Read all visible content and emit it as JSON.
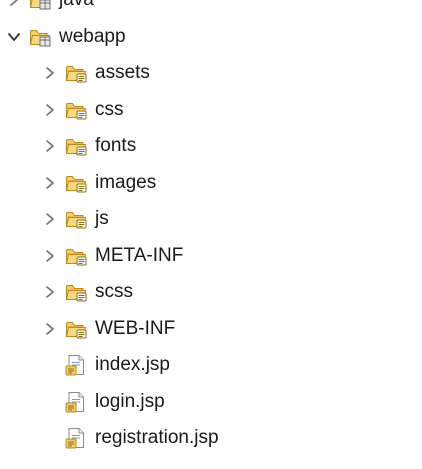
{
  "explorer": {
    "partial_top_item": {
      "label": "java"
    },
    "root": {
      "label": "webapp",
      "expanded": true
    },
    "children": [
      {
        "label": "assets",
        "type": "folder"
      },
      {
        "label": "css",
        "type": "folder"
      },
      {
        "label": "fonts",
        "type": "folder"
      },
      {
        "label": "images",
        "type": "folder"
      },
      {
        "label": "js",
        "type": "folder"
      },
      {
        "label": "META-INF",
        "type": "folder"
      },
      {
        "label": "scss",
        "type": "folder"
      },
      {
        "label": "WEB-INF",
        "type": "folder"
      },
      {
        "label": "index.jsp",
        "type": "file"
      },
      {
        "label": "login.jsp",
        "type": "file"
      },
      {
        "label": "registration.jsp",
        "type": "file"
      }
    ]
  },
  "icons": {
    "chevron_right": "chevron-right-icon",
    "chevron_down": "chevron-down-icon",
    "package_folder": "package-folder-icon",
    "folder": "folder-icon",
    "jsp_file": "jsp-file-icon"
  },
  "colors": {
    "folder_fill": "#f5cd6b",
    "folder_outline": "#b88a1f",
    "chevron": "#6f6f6f",
    "text": "#1a1a1a"
  }
}
